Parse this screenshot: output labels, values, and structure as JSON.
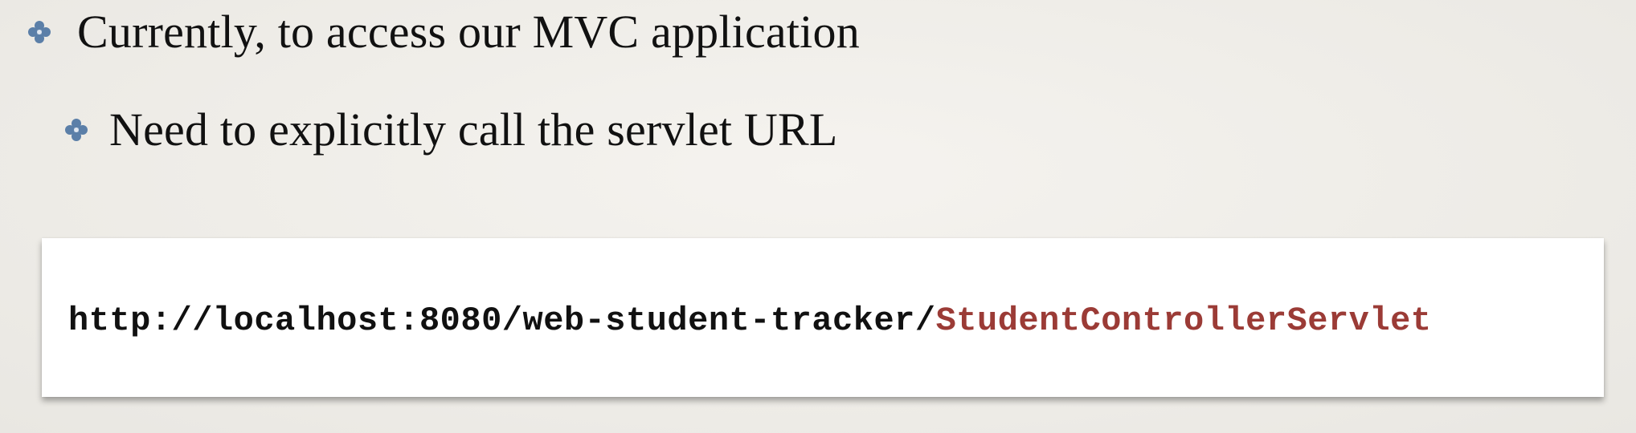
{
  "bullets": [
    {
      "text": "Currently, to access our MVC application",
      "icon": "flower-bullet-icon"
    },
    {
      "text": "Need to explicitly call the servlet URL",
      "icon": "flower-bullet-icon"
    }
  ],
  "url": {
    "prefix": "http://localhost:8080/web-student-tracker/",
    "servlet": "StudentControllerServlet"
  },
  "colors": {
    "bullet": "#5b7fa8",
    "highlight": "#9b3b36",
    "background": "#efede8"
  }
}
